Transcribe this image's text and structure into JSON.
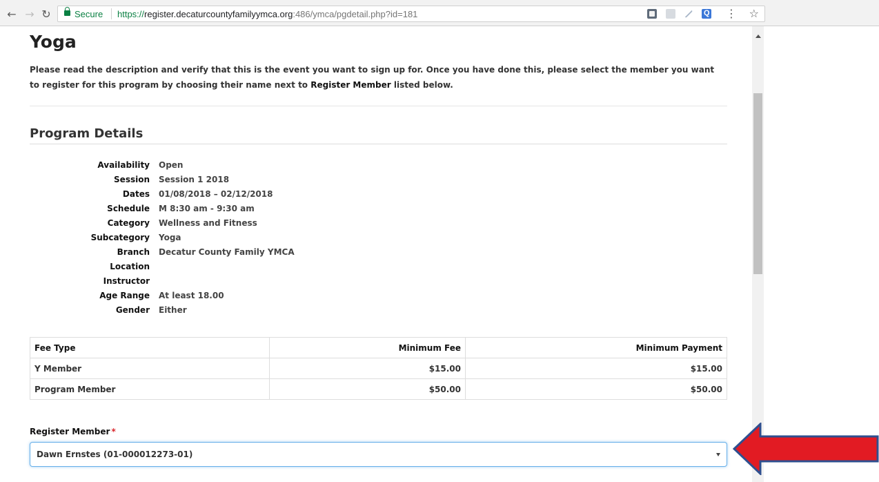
{
  "browser": {
    "secure_label": "Secure",
    "url_scheme": "https://",
    "url_host": "register.decaturcountyfamilyymca.org",
    "url_rest": ":486/ymca/pgdetail.php?id=181",
    "icons": [
      "back-icon",
      "forward-icon",
      "reload-icon",
      "lock-icon",
      "star-icon",
      "menu-icon"
    ]
  },
  "page": {
    "title": "Yoga",
    "intro_part1": "Please read the description and verify that this is the event you want to sign up for. Once you have done this, please select the member you want to register for this program by choosing their name next to ",
    "intro_emphasis": "Register Member",
    "intro_part2": " listed below."
  },
  "program_details": {
    "heading": "Program Details",
    "rows": [
      {
        "label": "Availability",
        "value": "Open"
      },
      {
        "label": "Session",
        "value": "Session 1 2018"
      },
      {
        "label": "Dates",
        "value": "01/08/2018 – 02/12/2018"
      },
      {
        "label": "Schedule",
        "value": "M 8:30 am - 9:30 am"
      },
      {
        "label": "Category",
        "value": "Wellness and Fitness"
      },
      {
        "label": "Subcategory",
        "value": "Yoga"
      },
      {
        "label": "Branch",
        "value": "Decatur County Family YMCA"
      },
      {
        "label": "Location",
        "value": ""
      },
      {
        "label": "Instructor",
        "value": ""
      },
      {
        "label": "Age Range",
        "value": "At least 18.00"
      },
      {
        "label": "Gender",
        "value": "Either"
      }
    ]
  },
  "fees": {
    "headers": [
      "Fee Type",
      "Minimum Fee",
      "Minimum Payment"
    ],
    "rows": [
      [
        "Y Member",
        "$15.00",
        "$15.00"
      ],
      [
        "Program Member",
        "$50.00",
        "$50.00"
      ]
    ]
  },
  "register": {
    "label": "Register Member",
    "required_mark": "*",
    "selected": "Dawn Ernstes (01-000012273-01)"
  },
  "annotation": {
    "arrow_color": "#e21b23",
    "arrow_outline": "#2f4f8f"
  }
}
